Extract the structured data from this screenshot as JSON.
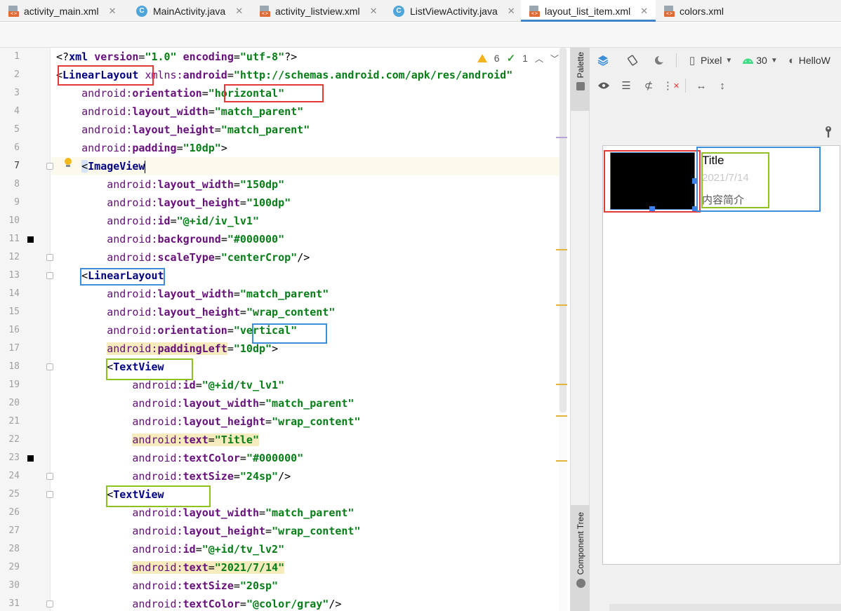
{
  "tabs": [
    {
      "label": "activity_main.xml",
      "kind": "xml",
      "active": false
    },
    {
      "label": "MainActivity.java",
      "kind": "java",
      "active": false
    },
    {
      "label": "activity_listview.xml",
      "kind": "xml",
      "active": false
    },
    {
      "label": "ListViewActivity.java",
      "kind": "java",
      "active": false
    },
    {
      "label": "layout_list_item.xml",
      "kind": "xml",
      "active": true
    },
    {
      "label": "colors.xml",
      "kind": "xml",
      "active": false
    }
  ],
  "inspection": {
    "warnings": "6",
    "checks": "1"
  },
  "editor": {
    "current_line": 7,
    "lines": [
      [
        {
          "t": "<?",
          "c": "plain"
        },
        {
          "t": "xml ",
          "c": "tag"
        },
        {
          "t": "version",
          "c": "attr"
        },
        {
          "t": "=",
          "c": "plain"
        },
        {
          "t": "\"1.0\"",
          "c": "val"
        },
        {
          "t": " ",
          "c": "plain"
        },
        {
          "t": "encoding",
          "c": "attr"
        },
        {
          "t": "=",
          "c": "plain"
        },
        {
          "t": "\"utf-8\"",
          "c": "val"
        },
        {
          "t": "?>",
          "c": "plain"
        }
      ],
      [
        {
          "t": "<",
          "c": "plain"
        },
        {
          "t": "LinearLayout",
          "c": "tag"
        },
        {
          "t": " ",
          "c": "plain"
        },
        {
          "t": "xmlns:",
          "c": "pre"
        },
        {
          "t": "android",
          "c": "attr"
        },
        {
          "t": "=",
          "c": "plain"
        },
        {
          "t": "\"http://schemas.android.com/apk/res/android\"",
          "c": "val"
        }
      ],
      [
        {
          "t": "    ",
          "c": "plain"
        },
        {
          "t": "android:",
          "c": "pre"
        },
        {
          "t": "orientation",
          "c": "attr"
        },
        {
          "t": "=",
          "c": "plain"
        },
        {
          "t": "\"horizontal\"",
          "c": "val"
        }
      ],
      [
        {
          "t": "    ",
          "c": "plain"
        },
        {
          "t": "android:",
          "c": "pre"
        },
        {
          "t": "layout_width",
          "c": "attr"
        },
        {
          "t": "=",
          "c": "plain"
        },
        {
          "t": "\"match_parent\"",
          "c": "val"
        }
      ],
      [
        {
          "t": "    ",
          "c": "plain"
        },
        {
          "t": "android:",
          "c": "pre"
        },
        {
          "t": "layout_height",
          "c": "attr"
        },
        {
          "t": "=",
          "c": "plain"
        },
        {
          "t": "\"match_parent\"",
          "c": "val"
        }
      ],
      [
        {
          "t": "    ",
          "c": "plain"
        },
        {
          "t": "android:",
          "c": "pre"
        },
        {
          "t": "padding",
          "c": "attr"
        },
        {
          "t": "=",
          "c": "plain"
        },
        {
          "t": "\"10dp\"",
          "c": "val"
        },
        {
          "t": ">",
          "c": "plain"
        }
      ],
      [
        {
          "t": "    ",
          "c": "plain"
        },
        {
          "t": "<",
          "c": "plain",
          "bg": "sel"
        },
        {
          "t": "ImageView",
          "c": "tag"
        },
        {
          "t": "",
          "c": "caret"
        }
      ],
      [
        {
          "t": "        ",
          "c": "plain"
        },
        {
          "t": "android:",
          "c": "pre"
        },
        {
          "t": "layout_width",
          "c": "attr"
        },
        {
          "t": "=",
          "c": "plain"
        },
        {
          "t": "\"150dp\"",
          "c": "val"
        }
      ],
      [
        {
          "t": "        ",
          "c": "plain"
        },
        {
          "t": "android:",
          "c": "pre"
        },
        {
          "t": "layout_height",
          "c": "attr"
        },
        {
          "t": "=",
          "c": "plain"
        },
        {
          "t": "\"100dp\"",
          "c": "val"
        }
      ],
      [
        {
          "t": "        ",
          "c": "plain"
        },
        {
          "t": "android:",
          "c": "pre"
        },
        {
          "t": "id",
          "c": "attr"
        },
        {
          "t": "=",
          "c": "plain"
        },
        {
          "t": "\"@+id/iv_lv1\"",
          "c": "val"
        }
      ],
      [
        {
          "t": "        ",
          "c": "plain"
        },
        {
          "t": "android:",
          "c": "pre"
        },
        {
          "t": "background",
          "c": "attr"
        },
        {
          "t": "=",
          "c": "plain"
        },
        {
          "t": "\"#000000\"",
          "c": "val"
        }
      ],
      [
        {
          "t": "        ",
          "c": "plain"
        },
        {
          "t": "android:",
          "c": "pre"
        },
        {
          "t": "scaleType",
          "c": "attr"
        },
        {
          "t": "=",
          "c": "plain"
        },
        {
          "t": "\"centerCrop\"",
          "c": "val"
        },
        {
          "t": "/>",
          "c": "plain"
        }
      ],
      [
        {
          "t": "    ",
          "c": "plain"
        },
        {
          "t": "<",
          "c": "plain"
        },
        {
          "t": "LinearLayout",
          "c": "tag"
        }
      ],
      [
        {
          "t": "        ",
          "c": "plain"
        },
        {
          "t": "android:",
          "c": "pre"
        },
        {
          "t": "layout_width",
          "c": "attr"
        },
        {
          "t": "=",
          "c": "plain"
        },
        {
          "t": "\"match_parent\"",
          "c": "val"
        }
      ],
      [
        {
          "t": "        ",
          "c": "plain"
        },
        {
          "t": "android:",
          "c": "pre"
        },
        {
          "t": "layout_height",
          "c": "attr"
        },
        {
          "t": "=",
          "c": "plain"
        },
        {
          "t": "\"wrap_content\"",
          "c": "val"
        }
      ],
      [
        {
          "t": "        ",
          "c": "plain"
        },
        {
          "t": "android:",
          "c": "pre"
        },
        {
          "t": "orientation",
          "c": "attr"
        },
        {
          "t": "=",
          "c": "plain"
        },
        {
          "t": "\"vertical\"",
          "c": "val"
        }
      ],
      [
        {
          "t": "        ",
          "c": "plain"
        },
        {
          "t": "android:",
          "c": "pre",
          "bg": "warn"
        },
        {
          "t": "paddingLeft",
          "c": "attr",
          "bg": "warn"
        },
        {
          "t": "=",
          "c": "plain"
        },
        {
          "t": "\"10dp\"",
          "c": "val"
        },
        {
          "t": ">",
          "c": "plain"
        }
      ],
      [
        {
          "t": "        ",
          "c": "plain"
        },
        {
          "t": "<",
          "c": "plain"
        },
        {
          "t": "TextView",
          "c": "tag"
        }
      ],
      [
        {
          "t": "            ",
          "c": "plain"
        },
        {
          "t": "android:",
          "c": "pre"
        },
        {
          "t": "id",
          "c": "attr"
        },
        {
          "t": "=",
          "c": "plain"
        },
        {
          "t": "\"@+id/tv_lv1\"",
          "c": "val"
        }
      ],
      [
        {
          "t": "            ",
          "c": "plain"
        },
        {
          "t": "android:",
          "c": "pre"
        },
        {
          "t": "layout_width",
          "c": "attr"
        },
        {
          "t": "=",
          "c": "plain"
        },
        {
          "t": "\"match_parent\"",
          "c": "val"
        }
      ],
      [
        {
          "t": "            ",
          "c": "plain"
        },
        {
          "t": "android:",
          "c": "pre"
        },
        {
          "t": "layout_height",
          "c": "attr"
        },
        {
          "t": "=",
          "c": "plain"
        },
        {
          "t": "\"wrap_content\"",
          "c": "val"
        }
      ],
      [
        {
          "t": "            ",
          "c": "plain"
        },
        {
          "t": "android:",
          "c": "pre",
          "bg": "warn"
        },
        {
          "t": "text",
          "c": "attr",
          "bg": "warn"
        },
        {
          "t": "=",
          "c": "plain",
          "bg": "warn"
        },
        {
          "t": "\"Title\"",
          "c": "val",
          "bg": "warn"
        }
      ],
      [
        {
          "t": "            ",
          "c": "plain"
        },
        {
          "t": "android:",
          "c": "pre"
        },
        {
          "t": "textColor",
          "c": "attr"
        },
        {
          "t": "=",
          "c": "plain"
        },
        {
          "t": "\"#000000\"",
          "c": "val"
        }
      ],
      [
        {
          "t": "            ",
          "c": "plain"
        },
        {
          "t": "android:",
          "c": "pre"
        },
        {
          "t": "textSize",
          "c": "attr"
        },
        {
          "t": "=",
          "c": "plain"
        },
        {
          "t": "\"24sp\"",
          "c": "val"
        },
        {
          "t": "/>",
          "c": "plain"
        }
      ],
      [
        {
          "t": "        ",
          "c": "plain"
        },
        {
          "t": "<",
          "c": "plain"
        },
        {
          "t": "TextView",
          "c": "tag"
        }
      ],
      [
        {
          "t": "            ",
          "c": "plain"
        },
        {
          "t": "android:",
          "c": "pre"
        },
        {
          "t": "layout_width",
          "c": "attr"
        },
        {
          "t": "=",
          "c": "plain"
        },
        {
          "t": "\"match_parent\"",
          "c": "val"
        }
      ],
      [
        {
          "t": "            ",
          "c": "plain"
        },
        {
          "t": "android:",
          "c": "pre"
        },
        {
          "t": "layout_height",
          "c": "attr"
        },
        {
          "t": "=",
          "c": "plain"
        },
        {
          "t": "\"wrap_content\"",
          "c": "val"
        }
      ],
      [
        {
          "t": "            ",
          "c": "plain"
        },
        {
          "t": "android:",
          "c": "pre"
        },
        {
          "t": "id",
          "c": "attr"
        },
        {
          "t": "=",
          "c": "plain"
        },
        {
          "t": "\"@+id/tv_lv2\"",
          "c": "val"
        }
      ],
      [
        {
          "t": "            ",
          "c": "plain"
        },
        {
          "t": "android:",
          "c": "pre",
          "bg": "warn"
        },
        {
          "t": "text",
          "c": "attr",
          "bg": "warn"
        },
        {
          "t": "=",
          "c": "plain",
          "bg": "warn"
        },
        {
          "t": "\"2021/7/14\"",
          "c": "val",
          "bg": "warn"
        }
      ],
      [
        {
          "t": "            ",
          "c": "plain"
        },
        {
          "t": "android:",
          "c": "pre"
        },
        {
          "t": "textSize",
          "c": "attr"
        },
        {
          "t": "=",
          "c": "plain"
        },
        {
          "t": "\"20sp\"",
          "c": "val"
        }
      ],
      [
        {
          "t": "            ",
          "c": "plain"
        },
        {
          "t": "android:",
          "c": "pre"
        },
        {
          "t": "textColor",
          "c": "attr"
        },
        {
          "t": "=",
          "c": "plain"
        },
        {
          "t": "\"@color/gray\"",
          "c": "val"
        },
        {
          "t": "/>",
          "c": "plain"
        }
      ]
    ]
  },
  "side_tabs": {
    "palette": "Palette",
    "component_tree": "Component Tree"
  },
  "design": {
    "device": "Pixel",
    "api": "30",
    "theme": "HelloW",
    "preview": {
      "title": "Title",
      "date": "2021/7/14",
      "desc": "内容简介"
    }
  },
  "colors": {
    "accent": "#4083c9",
    "red_box": "#e53935",
    "blue_box": "#3d8ed9",
    "green_box": "#8dc21f"
  }
}
